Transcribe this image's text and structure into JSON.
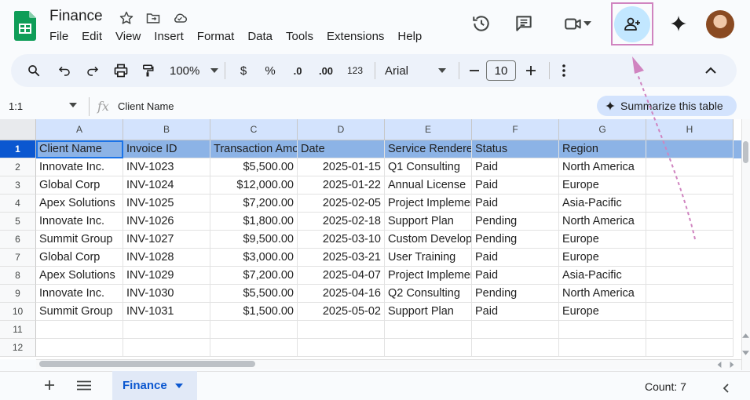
{
  "app": {
    "title": "Finance",
    "menu": [
      "File",
      "Edit",
      "View",
      "Insert",
      "Format",
      "Data",
      "Tools",
      "Extensions",
      "Help"
    ]
  },
  "toolbar": {
    "zoom": "100%",
    "currency": "$",
    "percent": "%",
    "dec_decrease": ".0",
    "dec_increase": ".00",
    "number_format": "123",
    "font": "Arial",
    "font_size": "10"
  },
  "formula_bar": {
    "name_box": "1:1",
    "fx": "fx",
    "content": "Client Name",
    "summarize": "Summarize this table"
  },
  "columns": [
    "A",
    "B",
    "C",
    "D",
    "E",
    "F",
    "G",
    "H"
  ],
  "row_numbers": [
    "1",
    "2",
    "3",
    "4",
    "5",
    "6",
    "7",
    "8",
    "9",
    "10",
    "11",
    "12"
  ],
  "header_row": [
    "Client Name",
    "Invoice ID",
    "Transaction Amount",
    "Date",
    "Service Rendered",
    "Status",
    "Region",
    ""
  ],
  "rows": [
    [
      "Innovate Inc.",
      "INV-1023",
      "$5,500.00",
      "2025-01-15",
      "Q1 Consulting",
      "Paid",
      "North America"
    ],
    [
      "Global Corp",
      "INV-1024",
      "$12,000.00",
      "2025-01-22",
      "Annual License",
      "Paid",
      "Europe"
    ],
    [
      "Apex Solutions",
      "INV-1025",
      "$7,200.00",
      "2025-02-05",
      "Project Implementation",
      "Paid",
      "Asia-Pacific"
    ],
    [
      "Innovate Inc.",
      "INV-1026",
      "$1,800.00",
      "2025-02-18",
      "Support Plan",
      "Pending",
      "North America"
    ],
    [
      "Summit Group",
      "INV-1027",
      "$9,500.00",
      "2025-03-10",
      "Custom Development",
      "Pending",
      "Europe"
    ],
    [
      "Global Corp",
      "INV-1028",
      "$3,000.00",
      "2025-03-21",
      "User Training",
      "Paid",
      "Europe"
    ],
    [
      "Apex Solutions",
      "INV-1029",
      "$7,200.00",
      "2025-04-07",
      "Project Implementation",
      "Paid",
      "Asia-Pacific"
    ],
    [
      "Innovate Inc.",
      "INV-1030",
      "$5,500.00",
      "2025-04-16",
      "Q2 Consulting",
      "Pending",
      "North America"
    ],
    [
      "Summit Group",
      "INV-1031",
      "$1,500.00",
      "2025-05-02",
      "Support Plan",
      "Paid",
      "Europe"
    ]
  ],
  "sheet_tab": "Finance",
  "status": {
    "count": "Count: 7"
  },
  "colors": {
    "accent": "#0b57d0",
    "selection_row": "#8cb3e6",
    "share_bg": "#c2e7ff",
    "annotation": "#d084c0"
  }
}
